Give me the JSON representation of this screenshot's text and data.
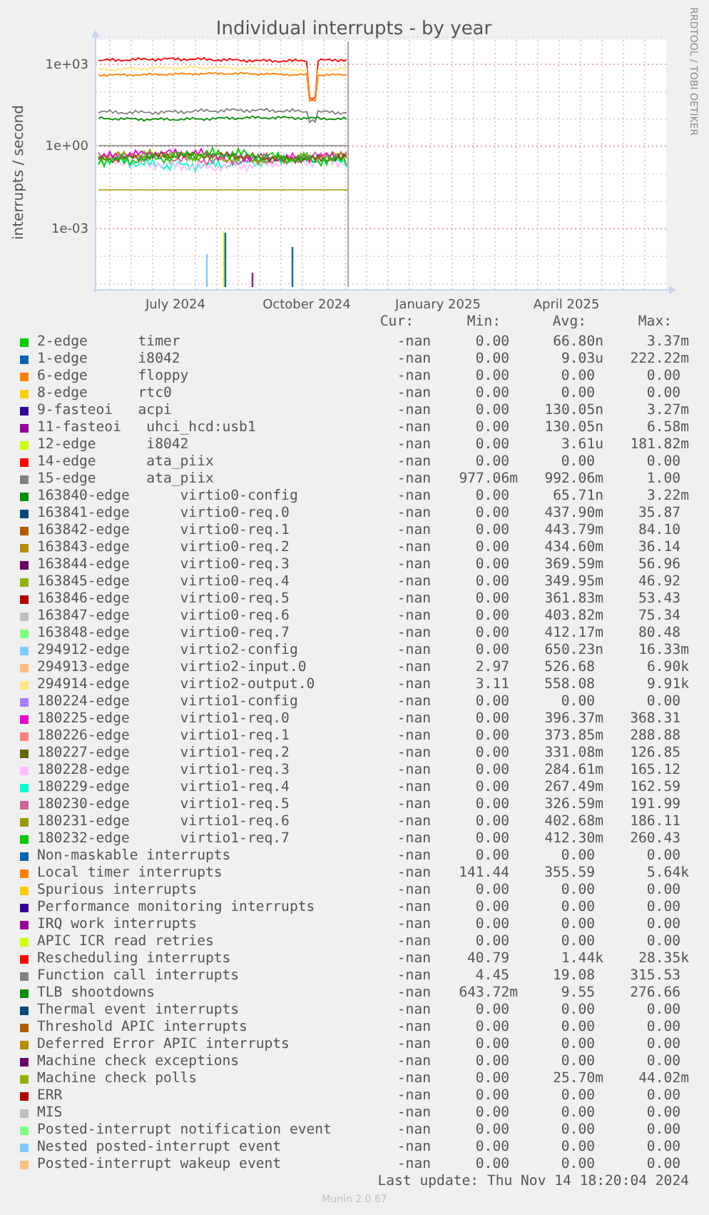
{
  "chart": {
    "title": "Individual interrupts - by year",
    "ylabel": "interrupts / second",
    "credit": "RRDTOOL / TOBI OETIKER",
    "yticks": [
      "1e+03",
      "1e+00",
      "1e-03"
    ],
    "xticks": [
      "July 2024",
      "October 2024",
      "January 2025",
      "April 2025"
    ]
  },
  "legend": {
    "columns": [
      "Cur:",
      "Min:",
      "Avg:",
      "Max:"
    ],
    "rows": [
      {
        "label": "2-edge      timer",
        "color": "#00cc00",
        "cur": "-nan",
        "min": "0.00",
        "avg": "66.80n",
        "max": "3.37m"
      },
      {
        "label": "1-edge      i8042",
        "color": "#0066b3",
        "cur": "-nan",
        "min": "0.00",
        "avg": "9.03u",
        "max": "222.22m"
      },
      {
        "label": "6-edge      floppy",
        "color": "#ff8000",
        "cur": "-nan",
        "min": "0.00",
        "avg": "0.00",
        "max": "0.00"
      },
      {
        "label": "8-edge      rtc0",
        "color": "#ffcc00",
        "cur": "-nan",
        "min": "0.00",
        "avg": "0.00",
        "max": "0.00"
      },
      {
        "label": "9-fasteoi   acpi",
        "color": "#330099",
        "cur": "-nan",
        "min": "0.00",
        "avg": "130.05n",
        "max": "3.27m"
      },
      {
        "label": "11-fasteoi   uhci_hcd:usb1",
        "color": "#990099",
        "cur": "-nan",
        "min": "0.00",
        "avg": "130.05n",
        "max": "6.58m"
      },
      {
        "label": "12-edge      i8042",
        "color": "#ccff00",
        "cur": "-nan",
        "min": "0.00",
        "avg": "3.61u",
        "max": "181.82m"
      },
      {
        "label": "14-edge      ata_piix",
        "color": "#ff0000",
        "cur": "-nan",
        "min": "0.00",
        "avg": "0.00",
        "max": "0.00"
      },
      {
        "label": "15-edge      ata_piix",
        "color": "#808080",
        "cur": "-nan",
        "min": "977.06m",
        "avg": "992.06m",
        "max": "1.00"
      },
      {
        "label": "163840-edge      virtio0-config",
        "color": "#008f00",
        "cur": "-nan",
        "min": "0.00",
        "avg": "65.71n",
        "max": "3.22m"
      },
      {
        "label": "163841-edge      virtio0-req.0",
        "color": "#00487d",
        "cur": "-nan",
        "min": "0.00",
        "avg": "437.90m",
        "max": "35.87"
      },
      {
        "label": "163842-edge      virtio0-req.1",
        "color": "#b35a00",
        "cur": "-nan",
        "min": "0.00",
        "avg": "443.79m",
        "max": "84.10"
      },
      {
        "label": "163843-edge      virtio0-req.2",
        "color": "#b38f00",
        "cur": "-nan",
        "min": "0.00",
        "avg": "434.60m",
        "max": "36.14"
      },
      {
        "label": "163844-edge      virtio0-req.3",
        "color": "#6b006b",
        "cur": "-nan",
        "min": "0.00",
        "avg": "369.59m",
        "max": "56.96"
      },
      {
        "label": "163845-edge      virtio0-req.4",
        "color": "#8fb300",
        "cur": "-nan",
        "min": "0.00",
        "avg": "349.95m",
        "max": "46.92"
      },
      {
        "label": "163846-edge      virtio0-req.5",
        "color": "#b30000",
        "cur": "-nan",
        "min": "0.00",
        "avg": "361.83m",
        "max": "53.43"
      },
      {
        "label": "163847-edge      virtio0-req.6",
        "color": "#bebebe",
        "cur": "-nan",
        "min": "0.00",
        "avg": "403.82m",
        "max": "75.34"
      },
      {
        "label": "163848-edge      virtio0-req.7",
        "color": "#80ff80",
        "cur": "-nan",
        "min": "0.00",
        "avg": "412.17m",
        "max": "80.48"
      },
      {
        "label": "294912-edge      virtio2-config",
        "color": "#80c9ff",
        "cur": "-nan",
        "min": "0.00",
        "avg": "650.23n",
        "max": "16.33m"
      },
      {
        "label": "294913-edge      virtio2-input.0",
        "color": "#ffc080",
        "cur": "-nan",
        "min": "2.97",
        "avg": "526.68",
        "max": "6.90k"
      },
      {
        "label": "294914-edge      virtio2-output.0",
        "color": "#ffe680",
        "cur": "-nan",
        "min": "3.11",
        "avg": "558.08",
        "max": "9.91k"
      },
      {
        "label": "180224-edge      virtio1-config",
        "color": "#aa80ff",
        "cur": "-nan",
        "min": "0.00",
        "avg": "0.00",
        "max": "0.00"
      },
      {
        "label": "180225-edge      virtio1-req.0",
        "color": "#ee00cc",
        "cur": "-nan",
        "min": "0.00",
        "avg": "396.37m",
        "max": "368.31"
      },
      {
        "label": "180226-edge      virtio1-req.1",
        "color": "#ff8080",
        "cur": "-nan",
        "min": "0.00",
        "avg": "373.85m",
        "max": "288.88"
      },
      {
        "label": "180227-edge      virtio1-req.2",
        "color": "#666600",
        "cur": "-nan",
        "min": "0.00",
        "avg": "331.08m",
        "max": "126.85"
      },
      {
        "label": "180228-edge      virtio1-req.3",
        "color": "#ffbfff",
        "cur": "-nan",
        "min": "0.00",
        "avg": "284.61m",
        "max": "165.12"
      },
      {
        "label": "180229-edge      virtio1-req.4",
        "color": "#00ffcc",
        "cur": "-nan",
        "min": "0.00",
        "avg": "267.49m",
        "max": "162.59"
      },
      {
        "label": "180230-edge      virtio1-req.5",
        "color": "#cc6699",
        "cur": "-nan",
        "min": "0.00",
        "avg": "326.59m",
        "max": "191.99"
      },
      {
        "label": "180231-edge      virtio1-req.6",
        "color": "#999900",
        "cur": "-nan",
        "min": "0.00",
        "avg": "402.68m",
        "max": "186.11"
      },
      {
        "label": "180232-edge      virtio1-req.7",
        "color": "#00cc00",
        "cur": "-nan",
        "min": "0.00",
        "avg": "412.30m",
        "max": "260.43"
      },
      {
        "label": "Non-maskable interrupts",
        "color": "#0066b3",
        "cur": "-nan",
        "min": "0.00",
        "avg": "0.00",
        "max": "0.00"
      },
      {
        "label": "Local timer interrupts",
        "color": "#ff8000",
        "cur": "-nan",
        "min": "141.44",
        "avg": "355.59",
        "max": "5.64k"
      },
      {
        "label": "Spurious interrupts",
        "color": "#ffcc00",
        "cur": "-nan",
        "min": "0.00",
        "avg": "0.00",
        "max": "0.00"
      },
      {
        "label": "Performance monitoring interrupts",
        "color": "#330099",
        "cur": "-nan",
        "min": "0.00",
        "avg": "0.00",
        "max": "0.00"
      },
      {
        "label": "IRQ work interrupts",
        "color": "#990099",
        "cur": "-nan",
        "min": "0.00",
        "avg": "0.00",
        "max": "0.00"
      },
      {
        "label": "APIC ICR read retries",
        "color": "#ccff00",
        "cur": "-nan",
        "min": "0.00",
        "avg": "0.00",
        "max": "0.00"
      },
      {
        "label": "Rescheduling interrupts",
        "color": "#ff0000",
        "cur": "-nan",
        "min": "40.79",
        "avg": "1.44k",
        "max": "28.35k"
      },
      {
        "label": "Function call interrupts",
        "color": "#808080",
        "cur": "-nan",
        "min": "4.45",
        "avg": "19.08",
        "max": "315.53"
      },
      {
        "label": "TLB shootdowns",
        "color": "#008f00",
        "cur": "-nan",
        "min": "643.72m",
        "avg": "9.55",
        "max": "276.66"
      },
      {
        "label": "Thermal event interrupts",
        "color": "#00487d",
        "cur": "-nan",
        "min": "0.00",
        "avg": "0.00",
        "max": "0.00"
      },
      {
        "label": "Threshold APIC interrupts",
        "color": "#b35a00",
        "cur": "-nan",
        "min": "0.00",
        "avg": "0.00",
        "max": "0.00"
      },
      {
        "label": "Deferred Error APIC interrupts",
        "color": "#b38f00",
        "cur": "-nan",
        "min": "0.00",
        "avg": "0.00",
        "max": "0.00"
      },
      {
        "label": "Machine check exceptions",
        "color": "#6b006b",
        "cur": "-nan",
        "min": "0.00",
        "avg": "0.00",
        "max": "0.00"
      },
      {
        "label": "Machine check polls",
        "color": "#8fb300",
        "cur": "-nan",
        "min": "0.00",
        "avg": "25.70m",
        "max": "44.02m"
      },
      {
        "label": "ERR",
        "color": "#b30000",
        "cur": "-nan",
        "min": "0.00",
        "avg": "0.00",
        "max": "0.00"
      },
      {
        "label": "MIS",
        "color": "#bebebe",
        "cur": "-nan",
        "min": "0.00",
        "avg": "0.00",
        "max": "0.00"
      },
      {
        "label": "Posted-interrupt notification event",
        "color": "#80ff80",
        "cur": "-nan",
        "min": "0.00",
        "avg": "0.00",
        "max": "0.00"
      },
      {
        "label": "Nested posted-interrupt event",
        "color": "#80c9ff",
        "cur": "-nan",
        "min": "0.00",
        "avg": "0.00",
        "max": "0.00"
      },
      {
        "label": "Posted-interrupt wakeup event",
        "color": "#ffc080",
        "cur": "-nan",
        "min": "0.00",
        "avg": "0.00",
        "max": "0.00"
      }
    ]
  },
  "last_update": "Last update: Thu Nov 14 18:20:04 2024",
  "footer": "Munin 2.0.67"
}
